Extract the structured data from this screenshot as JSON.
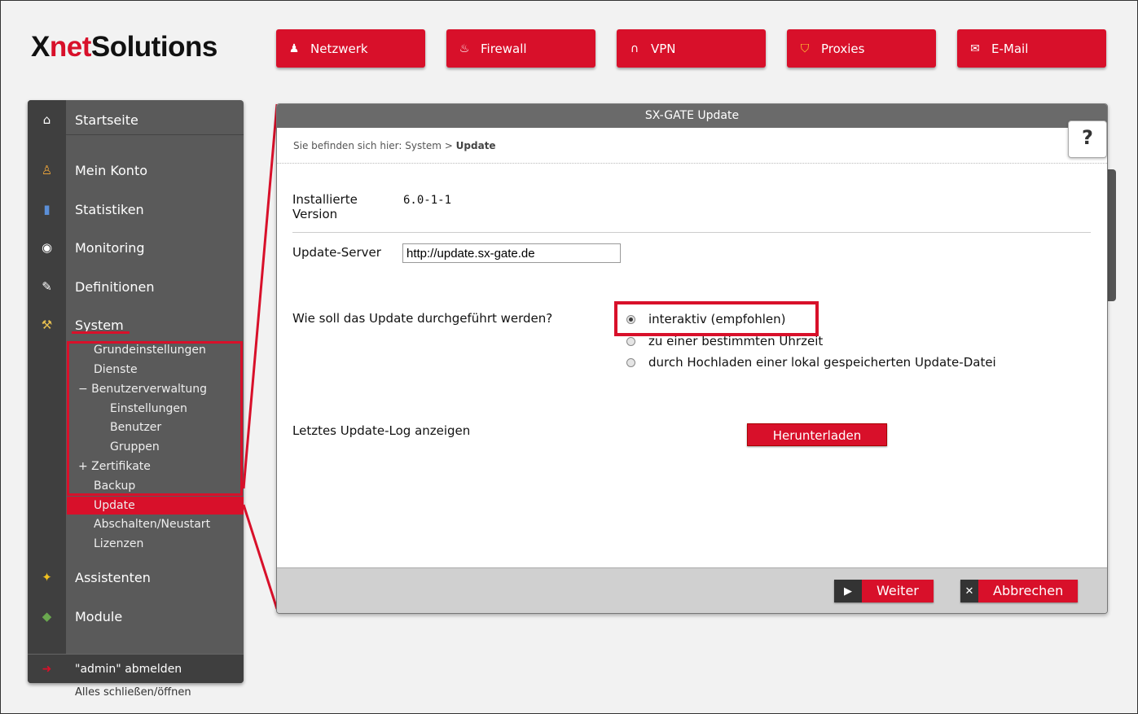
{
  "logo": {
    "part1": "X",
    "part2": "net",
    "part3": "Solutions"
  },
  "topnav": [
    {
      "label": "Netzwerk",
      "icon": "network-icon",
      "glyph": "♟"
    },
    {
      "label": "Firewall",
      "icon": "firewall-icon",
      "glyph": "♨"
    },
    {
      "label": "VPN",
      "icon": "vpn-icon",
      "glyph": "∩"
    },
    {
      "label": "Proxies",
      "icon": "shield-icon",
      "glyph": "⛉"
    },
    {
      "label": "E-Mail",
      "icon": "mail-icon",
      "glyph": "✉"
    }
  ],
  "sidebar": {
    "items": [
      {
        "label": "Startseite",
        "icon": "home-icon",
        "glyph": "⌂"
      },
      {
        "label": "Mein Konto",
        "icon": "user-icon",
        "glyph": "♙"
      },
      {
        "label": "Statistiken",
        "icon": "chart-icon",
        "glyph": "▮"
      },
      {
        "label": "Monitoring",
        "icon": "eye-icon",
        "glyph": "◉"
      },
      {
        "label": "Definitionen",
        "icon": "pen-icon",
        "glyph": "✎"
      },
      {
        "label": "System",
        "icon": "tools-icon",
        "glyph": "⚒"
      },
      {
        "label": "Assistenten",
        "icon": "wizard-icon",
        "glyph": "✦"
      },
      {
        "label": "Module",
        "icon": "modules-icon",
        "glyph": "◆"
      }
    ],
    "system_sub": {
      "grundeinstellungen": "Grundeinstellungen",
      "dienste": "Dienste",
      "benutzerverwaltung": "− Benutzerverwaltung",
      "einstellungen": "Einstellungen",
      "benutzer": "Benutzer",
      "gruppen": "Gruppen",
      "zertifikate": "+ Zertifikate",
      "backup": "Backup",
      "update": "Update",
      "abschalten": "Abschalten/Neustart",
      "lizenzen": "Lizenzen"
    },
    "logout_label": "\"admin\" abmelden",
    "close_all": "Alles schließen/öffnen"
  },
  "panel": {
    "title": "SX-GATE Update",
    "breadcrumb_prefix": "Sie befinden sich hier: System > ",
    "breadcrumb_current": "Update",
    "help_label": "?",
    "version_label_1": "Installierte",
    "version_label_2": "Version",
    "version_value": "6.0-1-1",
    "server_label": "Update-Server",
    "server_value": "http://update.sx-gate.de",
    "question": "Wie soll das Update durchgeführt werden?",
    "options": [
      "interaktiv (empfohlen)",
      "zu einer bestimmten Uhrzeit",
      "durch Hochladen einer lokal gespeicherten Update-Datei"
    ],
    "selected_option": 0,
    "log_label": "Letztes Update-Log anzeigen",
    "download_label": "Herunterladen",
    "next_label": "Weiter",
    "cancel_label": "Abbrechen"
  },
  "colors": {
    "accent": "#d8102a",
    "sidebar": "#5a5a5a",
    "sidebar_dark": "#3f3f3f"
  }
}
